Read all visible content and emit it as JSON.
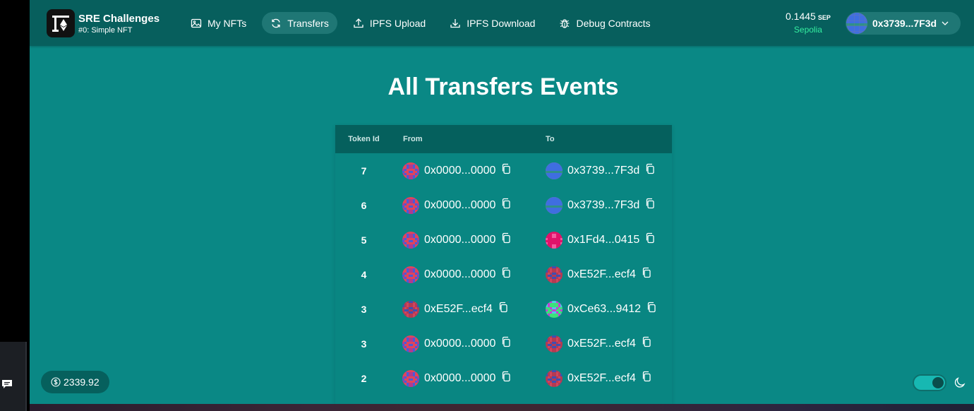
{
  "brand": {
    "title": "SRE Challenges",
    "subtitle": "#0: Simple NFT"
  },
  "nav": [
    {
      "label": "My NFTs",
      "icon": "image-icon",
      "active": false
    },
    {
      "label": "Transfers",
      "icon": "refresh-icon",
      "active": true
    },
    {
      "label": "IPFS Upload",
      "icon": "upload-icon",
      "active": false
    },
    {
      "label": "IPFS Download",
      "icon": "download-icon",
      "active": false
    },
    {
      "label": "Debug Contracts",
      "icon": "bug-icon",
      "active": false
    }
  ],
  "wallet": {
    "balance": "0.1445",
    "unit": "SEP",
    "network": "Sepolia",
    "address": "0x3739...7F3d"
  },
  "page": {
    "title": "All Transfers Events"
  },
  "table": {
    "headers": {
      "token_id": "Token Id",
      "from": "From",
      "to": "To"
    },
    "rows": [
      {
        "token_id": "7",
        "from": "0x0000...0000",
        "to": "0x3739...7F3d",
        "from_avatar": "zero",
        "to_avatar": "me"
      },
      {
        "token_id": "6",
        "from": "0x0000...0000",
        "to": "0x3739...7F3d",
        "from_avatar": "zero",
        "to_avatar": "me"
      },
      {
        "token_id": "5",
        "from": "0x0000...0000",
        "to": "0x1Fd4...0415",
        "from_avatar": "zero",
        "to_avatar": "pink"
      },
      {
        "token_id": "4",
        "from": "0x0000...0000",
        "to": "0xE52F...ecf4",
        "from_avatar": "zero",
        "to_avatar": "red"
      },
      {
        "token_id": "3",
        "from": "0xE52F...ecf4",
        "to": "0xCe63...9412",
        "from_avatar": "red",
        "to_avatar": "green"
      },
      {
        "token_id": "3",
        "from": "0x0000...0000",
        "to": "0xE52F...ecf4",
        "from_avatar": "zero",
        "to_avatar": "red"
      },
      {
        "token_id": "2",
        "from": "0x0000...0000",
        "to": "0xE52F...ecf4",
        "from_avatar": "zero",
        "to_avatar": "red"
      }
    ]
  },
  "footer": {
    "eth_price": "2339.92"
  },
  "colors": {
    "background": "#0a8885",
    "header": "#075f5d",
    "accent_green": "#34eea0",
    "table_header": "#05605d"
  }
}
